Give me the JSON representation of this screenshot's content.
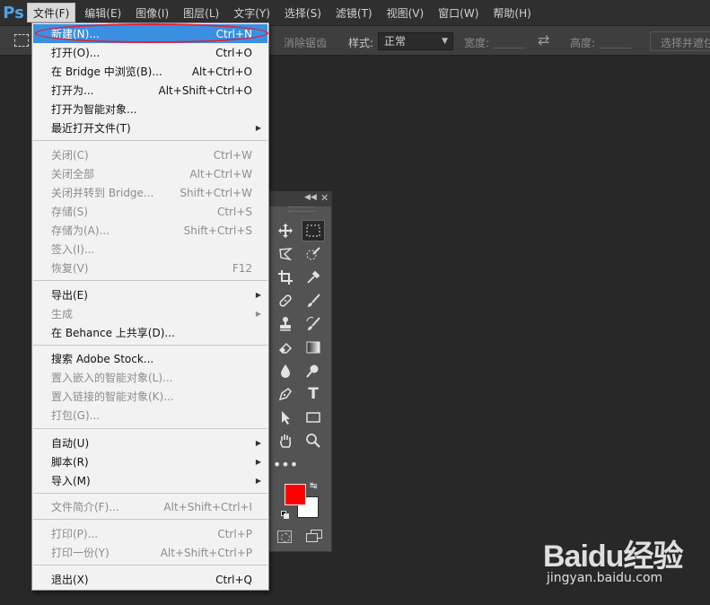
{
  "app": {
    "logo": "Ps"
  },
  "menubar": {
    "items": [
      {
        "label": "文件(F)",
        "active": true
      },
      {
        "label": "编辑(E)"
      },
      {
        "label": "图像(I)"
      },
      {
        "label": "图层(L)"
      },
      {
        "label": "文字(Y)"
      },
      {
        "label": "选择(S)"
      },
      {
        "label": "滤镜(T)"
      },
      {
        "label": "视图(V)"
      },
      {
        "label": "窗口(W)"
      },
      {
        "label": "帮助(H)"
      }
    ]
  },
  "options": {
    "feather_label": "消除锯齿",
    "style_label": "样式:",
    "style_value": "正常",
    "width_label": "宽度:",
    "height_label": "高度:",
    "select_mask": "选择并遮住"
  },
  "file_menu": {
    "items": [
      {
        "label": "新建(N)...",
        "shortcut": "Ctrl+N",
        "state": "highlighted"
      },
      {
        "label": "打开(O)...",
        "shortcut": "Ctrl+O"
      },
      {
        "label": "在 Bridge 中浏览(B)...",
        "shortcut": "Alt+Ctrl+O"
      },
      {
        "label": "打开为...",
        "shortcut": "Alt+Shift+Ctrl+O"
      },
      {
        "label": "打开为智能对象..."
      },
      {
        "label": "最近打开文件(T)",
        "submenu": true
      },
      {
        "label": "关闭(C)",
        "shortcut": "Ctrl+W",
        "state": "disabled"
      },
      {
        "label": "关闭全部",
        "shortcut": "Alt+Ctrl+W",
        "state": "disabled"
      },
      {
        "label": "关闭并转到 Bridge...",
        "shortcut": "Shift+Ctrl+W",
        "state": "disabled"
      },
      {
        "label": "存储(S)",
        "shortcut": "Ctrl+S",
        "state": "disabled"
      },
      {
        "label": "存储为(A)...",
        "shortcut": "Shift+Ctrl+S",
        "state": "disabled"
      },
      {
        "label": "签入(I)...",
        "state": "disabled"
      },
      {
        "label": "恢复(V)",
        "shortcut": "F12",
        "state": "disabled"
      },
      {
        "label": "导出(E)",
        "submenu": true
      },
      {
        "label": "生成",
        "submenu": true,
        "state": "disabled"
      },
      {
        "label": "在 Behance 上共享(D)..."
      },
      {
        "label": "搜索 Adobe Stock..."
      },
      {
        "label": "置入嵌入的智能对象(L)...",
        "state": "disabled"
      },
      {
        "label": "置入链接的智能对象(K)...",
        "state": "disabled"
      },
      {
        "label": "打包(G)...",
        "state": "disabled"
      },
      {
        "label": "自动(U)",
        "submenu": true
      },
      {
        "label": "脚本(R)",
        "submenu": true
      },
      {
        "label": "导入(M)",
        "submenu": true
      },
      {
        "label": "文件简介(F)...",
        "shortcut": "Alt+Shift+Ctrl+I",
        "state": "disabled"
      },
      {
        "label": "打印(P)...",
        "shortcut": "Ctrl+P",
        "state": "disabled"
      },
      {
        "label": "打印一份(Y)",
        "shortcut": "Alt+Shift+Ctrl+P",
        "state": "disabled"
      },
      {
        "label": "退出(X)",
        "shortcut": "Ctrl+Q"
      }
    ]
  },
  "tools": {
    "foreground_color": "#ff0000",
    "background_color": "#ffffff",
    "items": [
      "move-tool",
      "rectangular-marquee-tool",
      "lasso-tool",
      "quick-selection-tool",
      "crop-tool",
      "eyedropper-tool",
      "healing-brush-tool",
      "brush-tool",
      "clone-stamp-tool",
      "history-brush-tool",
      "eraser-tool",
      "gradient-tool",
      "blur-tool",
      "dodge-tool",
      "pen-tool",
      "type-tool",
      "path-selection-tool",
      "rectangle-tool",
      "hand-tool",
      "zoom-tool",
      "more-tools"
    ],
    "type_glyph": "T"
  },
  "watermark": {
    "brand": "Baidu经验",
    "url": "jingyan.baidu.com"
  }
}
